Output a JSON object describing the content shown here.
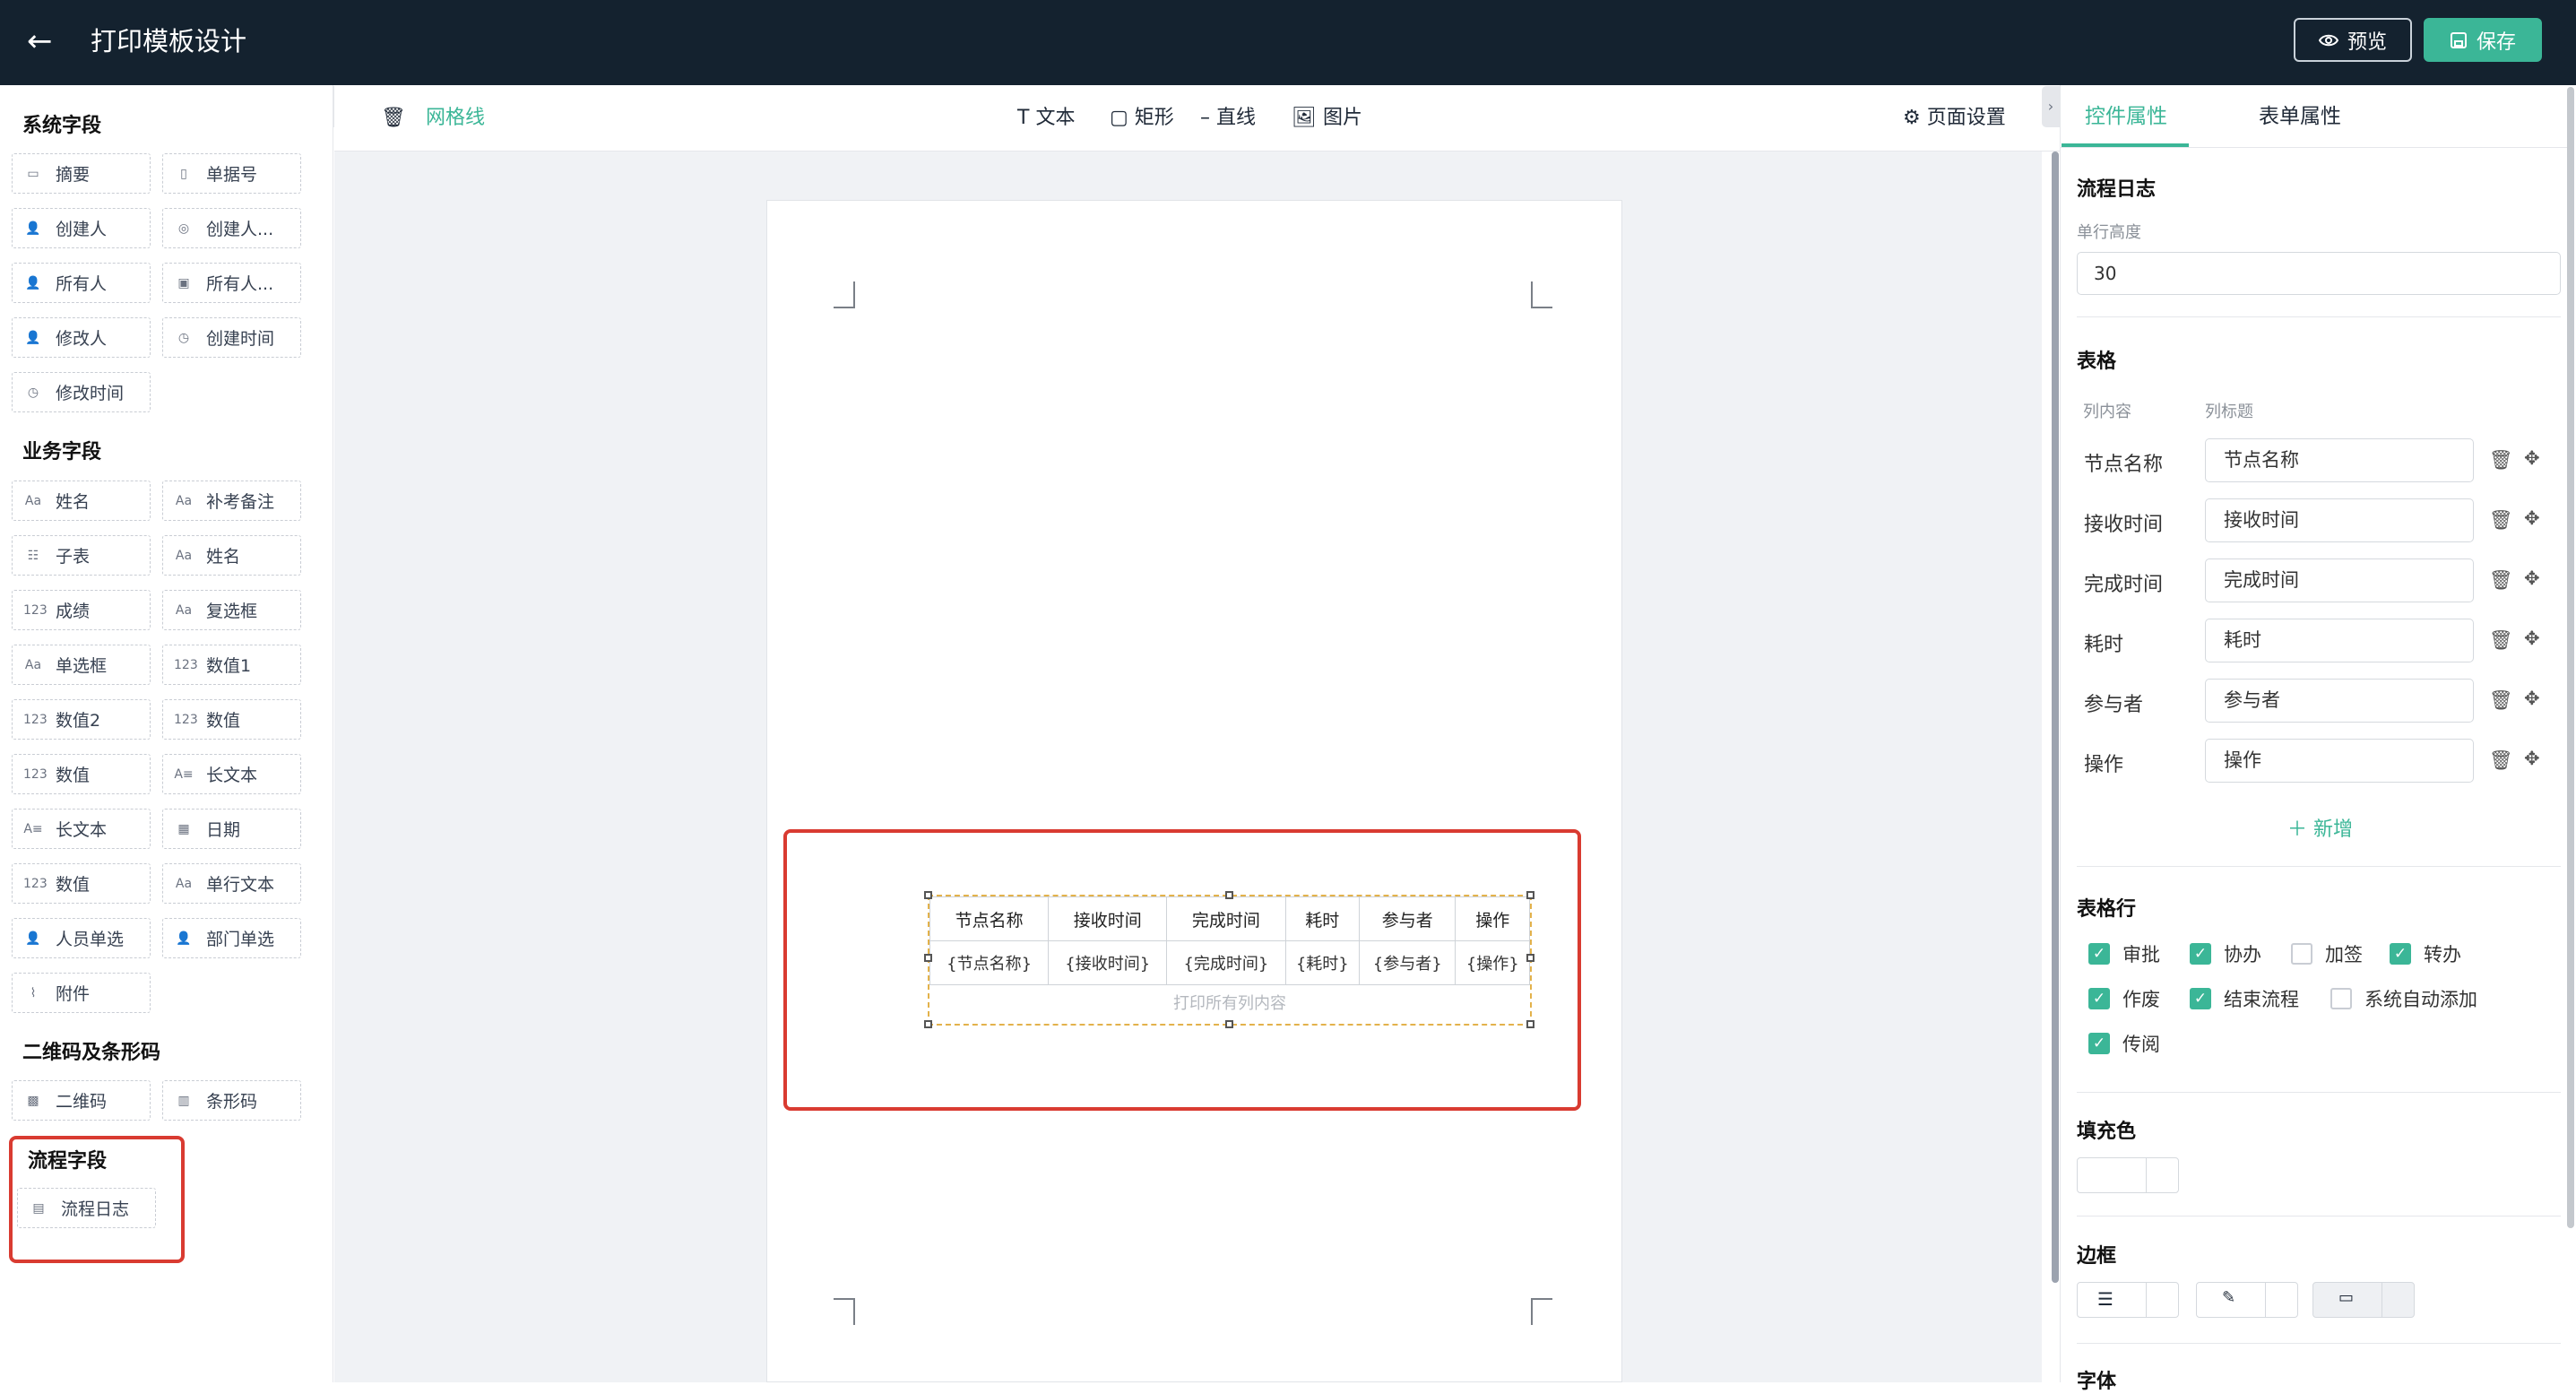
{
  "header": {
    "title": "打印模板设计",
    "preview_label": "预览",
    "save_label": "保存"
  },
  "left": {
    "system_title": "系统字段",
    "system_fields": [
      {
        "label": "摘要",
        "icon": "summary-icon"
      },
      {
        "label": "单据号",
        "icon": "doc-number-icon"
      },
      {
        "label": "创建人",
        "icon": "user-icon"
      },
      {
        "label": "创建人...",
        "icon": "department-icon"
      },
      {
        "label": "所有人",
        "icon": "user-icon"
      },
      {
        "label": "所有人...",
        "icon": "image-icon"
      },
      {
        "label": "修改人",
        "icon": "user-icon"
      },
      {
        "label": "创建时间",
        "icon": "clock-icon"
      },
      {
        "label": "修改时间",
        "icon": "clock-icon"
      }
    ],
    "business_title": "业务字段",
    "business_fields": [
      {
        "label": "姓名",
        "icon": "text-icon"
      },
      {
        "label": "补考备注",
        "icon": "text-icon"
      },
      {
        "label": "子表",
        "icon": "subtable-icon"
      },
      {
        "label": "姓名",
        "icon": "text-icon"
      },
      {
        "label": "成绩",
        "icon": "number-icon"
      },
      {
        "label": "复选框",
        "icon": "text-icon"
      },
      {
        "label": "单选框",
        "icon": "text-icon"
      },
      {
        "label": "数值1",
        "icon": "number-icon"
      },
      {
        "label": "数值2",
        "icon": "number-icon"
      },
      {
        "label": "数值",
        "icon": "number-icon"
      },
      {
        "label": "数值",
        "icon": "number-icon"
      },
      {
        "label": "长文本",
        "icon": "long-text-icon"
      },
      {
        "label": "长文本",
        "icon": "long-text-icon"
      },
      {
        "label": "日期",
        "icon": "calendar-icon"
      },
      {
        "label": "数值",
        "icon": "number-icon"
      },
      {
        "label": "单行文本",
        "icon": "text-icon"
      },
      {
        "label": "人员单选",
        "icon": "user-icon"
      },
      {
        "label": "部门单选",
        "icon": "user-icon"
      },
      {
        "label": "附件",
        "icon": "paperclip-icon"
      }
    ],
    "code_title": "二维码及条形码",
    "code_fields": [
      {
        "label": "二维码",
        "icon": "qrcode-icon"
      },
      {
        "label": "条形码",
        "icon": "barcode-icon"
      }
    ],
    "flow_title": "流程字段",
    "flow_fields": [
      {
        "label": "流程日志",
        "icon": "log-icon"
      }
    ]
  },
  "toolbar": {
    "grid": "网格线",
    "text": "文本",
    "rect": "矩形",
    "line": "直线",
    "image": "图片",
    "page_settings": "页面设置"
  },
  "canvas_table": {
    "headers": [
      "节点名称",
      "接收时间",
      "完成时间",
      "耗时",
      "参与者",
      "操作"
    ],
    "cells": [
      "{节点名称}",
      "{接收时间}",
      "{完成时间}",
      "{耗时}",
      "{参与者}",
      "{操作}"
    ],
    "footer": "打印所有列内容"
  },
  "right": {
    "tab_control": "控件属性",
    "tab_form": "表单属性",
    "component_title": "流程日志",
    "row_height_label": "单行高度",
    "row_height_value": "30",
    "table_title": "表格",
    "col_content_label": "列内容",
    "col_title_label": "列标题",
    "columns": [
      {
        "content": "节点名称",
        "title": "节点名称"
      },
      {
        "content": "接收时间",
        "title": "接收时间"
      },
      {
        "content": "完成时间",
        "title": "完成时间"
      },
      {
        "content": "耗时",
        "title": "耗时"
      },
      {
        "content": "参与者",
        "title": "参与者"
      },
      {
        "content": "操作",
        "title": "操作"
      }
    ],
    "add_label": "新增",
    "rows_title": "表格行",
    "row_checks": [
      {
        "label": "审批",
        "checked": true
      },
      {
        "label": "协办",
        "checked": true
      },
      {
        "label": "加签",
        "checked": false
      },
      {
        "label": "转办",
        "checked": true
      },
      {
        "label": "作废",
        "checked": true
      },
      {
        "label": "结束流程",
        "checked": true
      },
      {
        "label": "系统自动添加",
        "checked": false
      },
      {
        "label": "传阅",
        "checked": true
      }
    ],
    "fill_title": "填充色",
    "border_title": "边框",
    "font_title": "字体"
  },
  "colors": {
    "accent": "#3bb697",
    "topbar": "#14222f",
    "highlight": "#d93b31"
  }
}
